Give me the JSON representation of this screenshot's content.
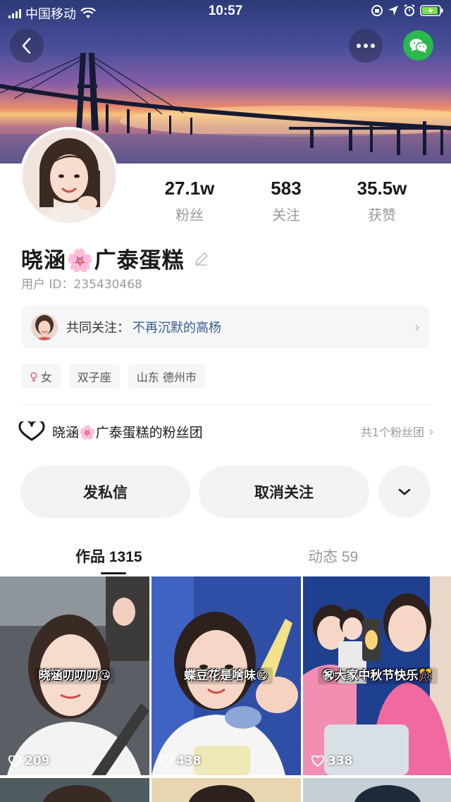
{
  "status_bar": {
    "carrier": "中国移动",
    "time": "10:57"
  },
  "header": {
    "back_icon": "chevron-left-icon",
    "more_icon": "more-dots-icon",
    "share_icon": "wechat-icon"
  },
  "profile": {
    "stats": [
      {
        "value": "27.1w",
        "label": "粉丝"
      },
      {
        "value": "583",
        "label": "关注"
      },
      {
        "value": "35.5w",
        "label": "获赞"
      }
    ],
    "name": "晓涵🌸广泰蛋糕",
    "user_id": "用户 ID：235430468"
  },
  "mutual_follow": {
    "label": "共同关注：",
    "name": "不再沉默的高杨"
  },
  "tags": [
    {
      "label": "女",
      "icon": "female-icon"
    },
    {
      "label": "双子座"
    },
    {
      "label": "山东 德州市"
    }
  ],
  "fan_club": {
    "title": "晓涵🌸广泰蛋糕的粉丝团",
    "count": "共1个粉丝团"
  },
  "actions": {
    "message": "发私信",
    "unfollow": "取消关注"
  },
  "tabs": [
    {
      "label": "作品 1315"
    },
    {
      "label": "动态 59"
    }
  ],
  "videos": [
    {
      "caption": "晓涵叨叨叨😘",
      "likes": "209"
    },
    {
      "caption": "蝶豆花是啥味😋",
      "likes": "438"
    },
    {
      "caption": "㊗大家中秋节快乐🎊",
      "likes": "338"
    }
  ],
  "colors": {
    "accent_link": "#3b5b8f",
    "wechat_green": "#2bb84f",
    "gender_pink": "#e2567c"
  }
}
